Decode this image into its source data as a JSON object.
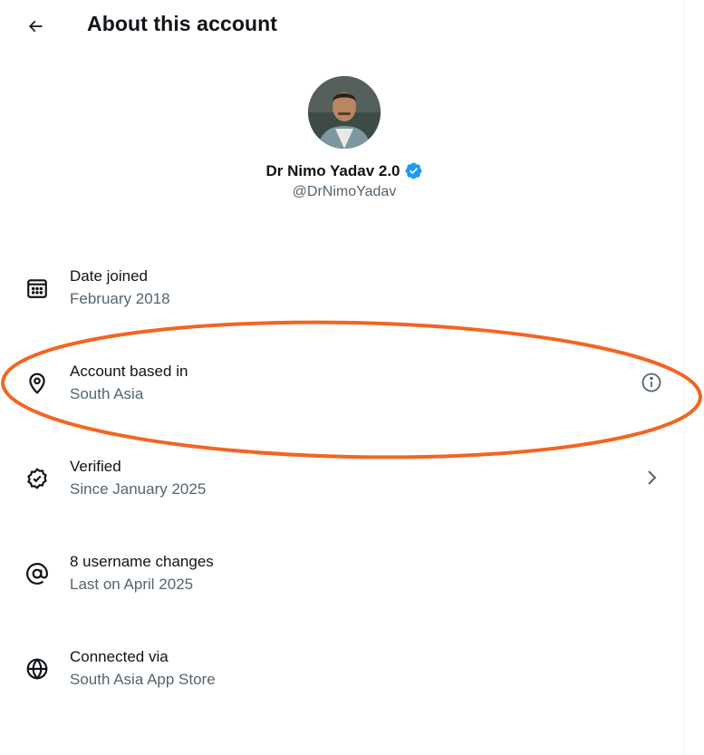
{
  "header": {
    "title": "About this account",
    "back_icon": "arrow-left-icon"
  },
  "profile": {
    "display_name": "Dr Nimo Yadav 2.0",
    "handle": "@DrNimoYadav",
    "verified_badge_color": "#1d9bf0"
  },
  "rows": [
    {
      "icon": "calendar-icon",
      "label": "Date joined",
      "value": "February 2018"
    },
    {
      "icon": "location-pin-icon",
      "label": "Account based in",
      "value": "South Asia",
      "trailing_icon": "info-icon"
    },
    {
      "icon": "verified-check-icon",
      "label": "Verified",
      "value": "Since January 2025",
      "trailing_icon": "chevron-right-icon"
    },
    {
      "icon": "at-sign-icon",
      "label": "8 username changes",
      "value": "Last on April 2025"
    },
    {
      "icon": "globe-icon",
      "label": "Connected via",
      "value": "South Asia App Store"
    }
  ],
  "annotation": {
    "color": "#f26522"
  },
  "colors": {
    "text_primary": "#0f1419",
    "text_secondary": "#536471"
  }
}
